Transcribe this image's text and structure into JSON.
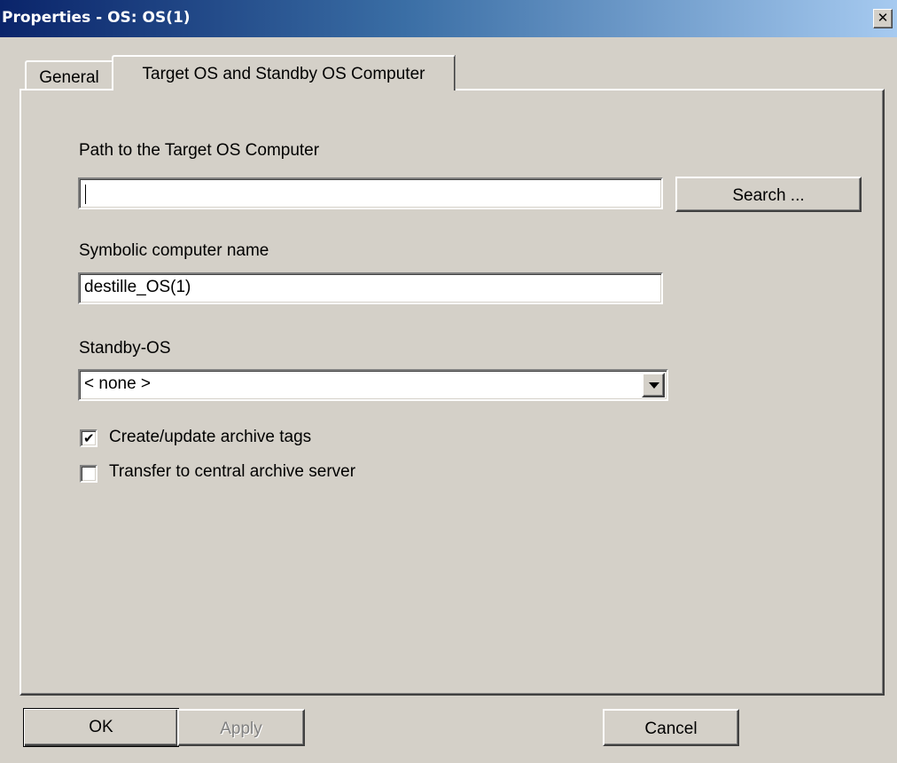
{
  "window": {
    "title": "Properties - OS: OS(1)",
    "close_glyph": "✕",
    "close_icon": "close-icon"
  },
  "tabs": [
    {
      "label": "General",
      "active": false
    },
    {
      "label": "Target OS and Standby OS Computer",
      "active": true
    }
  ],
  "target_path": {
    "label": "Path to the Target OS Computer",
    "value": "",
    "search_label": "Search ..."
  },
  "symbolic_name": {
    "label": "Symbolic computer name",
    "value": "destille_OS(1)"
  },
  "standby": {
    "label": "Standby-OS",
    "selected": "< none >",
    "arrow_icon": "chevron-down-icon"
  },
  "checkboxes": [
    {
      "label": "Create/update archive tags",
      "checked": true,
      "mark": "✔"
    },
    {
      "label": "Transfer to central archive server",
      "checked": false,
      "mark": ""
    }
  ],
  "buttons": {
    "ok": "OK",
    "apply": "Apply",
    "cancel": "Cancel"
  },
  "colors": {
    "title_start": "#0a246a",
    "title_end": "#a6caf0",
    "face": "#d4d0c8"
  }
}
